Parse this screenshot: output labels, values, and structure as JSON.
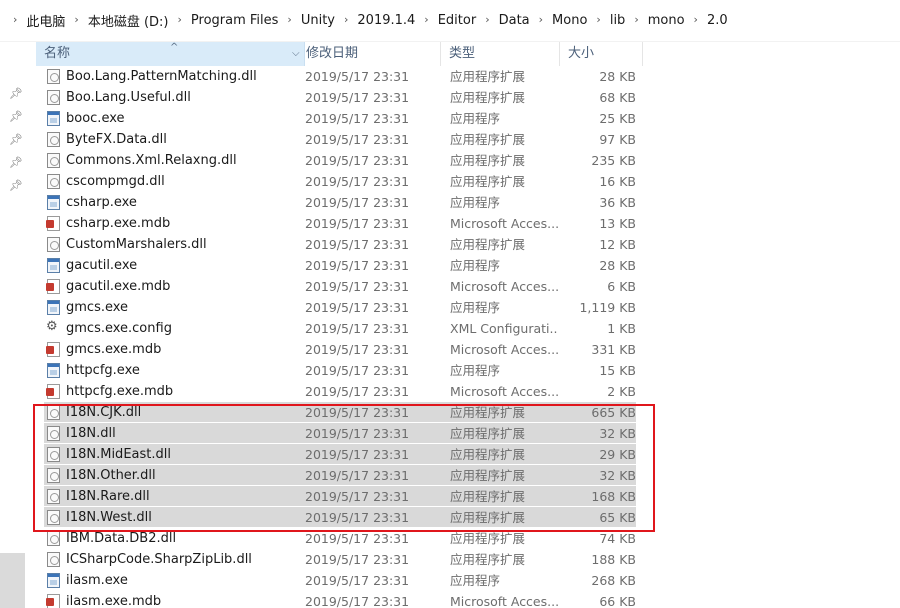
{
  "breadcrumb": [
    "此电脑",
    "本地磁盘 (D:)",
    "Program Files",
    "Unity",
    "2019.1.4",
    "Editor",
    "Data",
    "Mono",
    "lib",
    "mono",
    "2.0"
  ],
  "columns": {
    "name": "名称",
    "date": "修改日期",
    "type": "类型",
    "size": "大小"
  },
  "icons": {
    "dll": "dll-file-icon",
    "exe": "exe-file-icon",
    "mdb": "mdb-file-icon",
    "config": "config-file-icon",
    "pin": "pin-icon",
    "sort": "sort-up-icon"
  },
  "highlight_color": "#e0161c",
  "files": [
    {
      "name": "Boo.Lang.PatternMatching.dll",
      "date": "2019/5/17 23:31",
      "type": "应用程序扩展",
      "size": "28 KB",
      "icon": "dll",
      "selected": false
    },
    {
      "name": "Boo.Lang.Useful.dll",
      "date": "2019/5/17 23:31",
      "type": "应用程序扩展",
      "size": "68 KB",
      "icon": "dll",
      "selected": false
    },
    {
      "name": "booc.exe",
      "date": "2019/5/17 23:31",
      "type": "应用程序",
      "size": "25 KB",
      "icon": "exe",
      "selected": false
    },
    {
      "name": "ByteFX.Data.dll",
      "date": "2019/5/17 23:31",
      "type": "应用程序扩展",
      "size": "97 KB",
      "icon": "dll",
      "selected": false
    },
    {
      "name": "Commons.Xml.Relaxng.dll",
      "date": "2019/5/17 23:31",
      "type": "应用程序扩展",
      "size": "235 KB",
      "icon": "dll",
      "selected": false
    },
    {
      "name": "cscompmgd.dll",
      "date": "2019/5/17 23:31",
      "type": "应用程序扩展",
      "size": "16 KB",
      "icon": "dll",
      "selected": false
    },
    {
      "name": "csharp.exe",
      "date": "2019/5/17 23:31",
      "type": "应用程序",
      "size": "36 KB",
      "icon": "exe",
      "selected": false
    },
    {
      "name": "csharp.exe.mdb",
      "date": "2019/5/17 23:31",
      "type": "Microsoft Acces...",
      "size": "13 KB",
      "icon": "mdb",
      "selected": false
    },
    {
      "name": "CustomMarshalers.dll",
      "date": "2019/5/17 23:31",
      "type": "应用程序扩展",
      "size": "12 KB",
      "icon": "dll",
      "selected": false
    },
    {
      "name": "gacutil.exe",
      "date": "2019/5/17 23:31",
      "type": "应用程序",
      "size": "28 KB",
      "icon": "exe",
      "selected": false
    },
    {
      "name": "gacutil.exe.mdb",
      "date": "2019/5/17 23:31",
      "type": "Microsoft Acces...",
      "size": "6 KB",
      "icon": "mdb",
      "selected": false
    },
    {
      "name": "gmcs.exe",
      "date": "2019/5/17 23:31",
      "type": "应用程序",
      "size": "1,119 KB",
      "icon": "exe",
      "selected": false
    },
    {
      "name": "gmcs.exe.config",
      "date": "2019/5/17 23:31",
      "type": "XML Configurati...",
      "size": "1 KB",
      "icon": "config",
      "selected": false
    },
    {
      "name": "gmcs.exe.mdb",
      "date": "2019/5/17 23:31",
      "type": "Microsoft Acces...",
      "size": "331 KB",
      "icon": "mdb",
      "selected": false
    },
    {
      "name": "httpcfg.exe",
      "date": "2019/5/17 23:31",
      "type": "应用程序",
      "size": "15 KB",
      "icon": "exe",
      "selected": false
    },
    {
      "name": "httpcfg.exe.mdb",
      "date": "2019/5/17 23:31",
      "type": "Microsoft Acces...",
      "size": "2 KB",
      "icon": "mdb",
      "selected": false
    },
    {
      "name": "I18N.CJK.dll",
      "date": "2019/5/17 23:31",
      "type": "应用程序扩展",
      "size": "665 KB",
      "icon": "dll",
      "selected": true
    },
    {
      "name": "I18N.dll",
      "date": "2019/5/17 23:31",
      "type": "应用程序扩展",
      "size": "32 KB",
      "icon": "dll",
      "selected": true
    },
    {
      "name": "I18N.MidEast.dll",
      "date": "2019/5/17 23:31",
      "type": "应用程序扩展",
      "size": "29 KB",
      "icon": "dll",
      "selected": true
    },
    {
      "name": "I18N.Other.dll",
      "date": "2019/5/17 23:31",
      "type": "应用程序扩展",
      "size": "32 KB",
      "icon": "dll",
      "selected": true
    },
    {
      "name": "I18N.Rare.dll",
      "date": "2019/5/17 23:31",
      "type": "应用程序扩展",
      "size": "168 KB",
      "icon": "dll",
      "selected": true
    },
    {
      "name": "I18N.West.dll",
      "date": "2019/5/17 23:31",
      "type": "应用程序扩展",
      "size": "65 KB",
      "icon": "dll",
      "selected": true
    },
    {
      "name": "IBM.Data.DB2.dll",
      "date": "2019/5/17 23:31",
      "type": "应用程序扩展",
      "size": "74 KB",
      "icon": "dll",
      "selected": false
    },
    {
      "name": "ICSharpCode.SharpZipLib.dll",
      "date": "2019/5/17 23:31",
      "type": "应用程序扩展",
      "size": "188 KB",
      "icon": "dll",
      "selected": false
    },
    {
      "name": "ilasm.exe",
      "date": "2019/5/17 23:31",
      "type": "应用程序",
      "size": "268 KB",
      "icon": "exe",
      "selected": false
    },
    {
      "name": "ilasm.exe.mdb",
      "date": "2019/5/17 23:31",
      "type": "Microsoft Acces...",
      "size": "66 KB",
      "icon": "mdb",
      "selected": false
    }
  ]
}
